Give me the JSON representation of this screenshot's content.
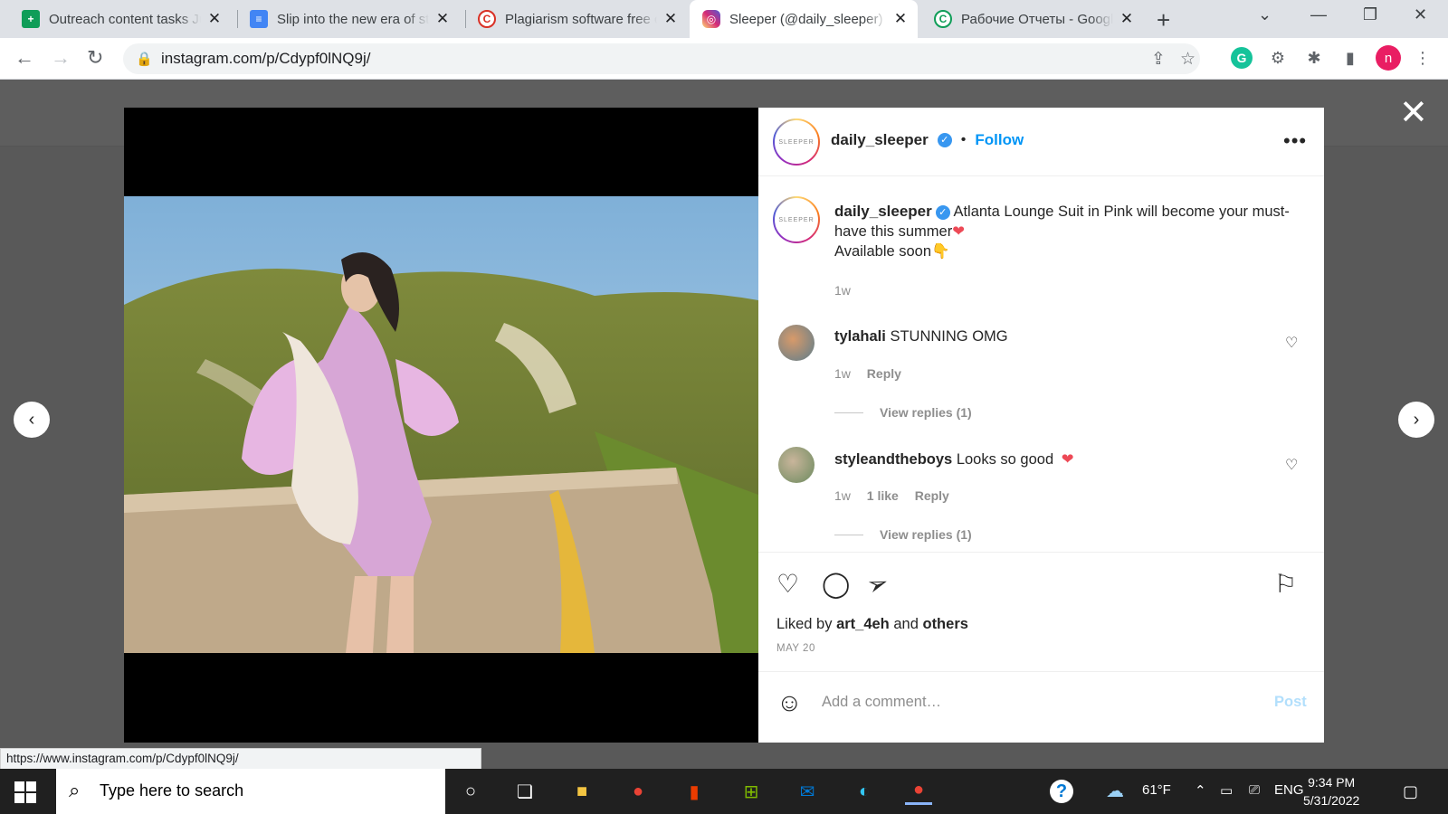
{
  "browser": {
    "tabs": [
      {
        "title": "Outreach content tasks Ju",
        "fav_color": "#0f9d58",
        "fav_glyph": "+"
      },
      {
        "title": "Slip into the new era of st",
        "fav_color": "#4285f4",
        "fav_glyph": "≡"
      },
      {
        "title": "Plagiarism software free c",
        "fav_color": "#d93025",
        "fav_glyph": "C"
      },
      {
        "title": "Sleeper (@daily_sleeper) ·",
        "fav_color": "#e1306c",
        "fav_glyph": "◎"
      },
      {
        "title": "Рабочие Отчеты - Googl",
        "fav_color": "#0f9d58",
        "fav_glyph": "C"
      }
    ],
    "url": "instagram.com/p/Cdypf0lNQ9j/",
    "profile_initial": "n",
    "status_url": "https://www.instagram.com/p/Cdypf0lNQ9j/"
  },
  "post": {
    "avatar_text": "SLEEPER",
    "username": "daily_sleeper",
    "verified_glyph": "✓",
    "dot": "•",
    "follow_label": "Follow",
    "more_label": "•••",
    "caption": "Atlanta Lounge Suit in Pink will become your must-have this summer",
    "caption_emoji": "❤",
    "caption_line2": "Available soon",
    "caption_emoji2": "👇",
    "caption_age": "1w",
    "comments": [
      {
        "user": "tylahali",
        "text": "STUNNING OMG",
        "age": "1w",
        "likes": "",
        "reply": "Reply",
        "view_replies": "View replies (1)"
      },
      {
        "user": "styleandtheboys",
        "text": "Looks so good",
        "emoji": "❤",
        "age": "1w",
        "likes": "1 like",
        "reply": "Reply",
        "view_replies": "View replies (1)"
      }
    ],
    "liked_by_prefix": "Liked by",
    "liked_by_user": "art_4eh",
    "liked_by_and": "and",
    "liked_by_others": "others",
    "date": "MAY 20",
    "comment_placeholder": "Add a comment…",
    "post_label": "Post"
  },
  "taskbar": {
    "search_placeholder": "Type here to search",
    "weather": "61°F",
    "lang": "ENG",
    "time": "9:34 PM",
    "date": "5/31/2022"
  },
  "colors": {
    "accent": "#0095f6",
    "verified": "#3897f0",
    "heart": "#ed4956"
  }
}
